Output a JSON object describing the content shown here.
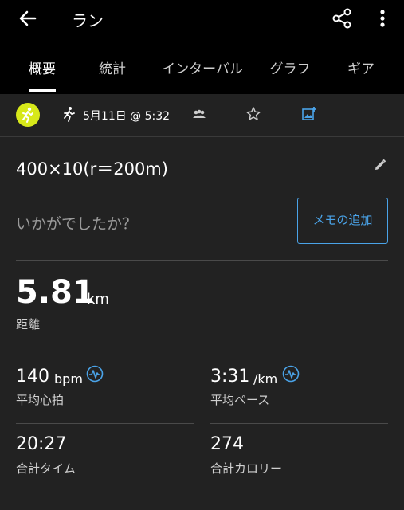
{
  "appbar": {
    "title": "ラン"
  },
  "tabs": [
    {
      "label": "概要"
    },
    {
      "label": "統計"
    },
    {
      "label": "インターバル"
    },
    {
      "label": "グラフ"
    },
    {
      "label": "ギア"
    }
  ],
  "activity": {
    "date": "5月11日 @ 5:32"
  },
  "workout": {
    "title": "400×10(r＝200m)"
  },
  "feedback": {
    "prompt": "いかがでしたか？",
    "memo_button": "メモの追加"
  },
  "distance": {
    "value": "5.81",
    "unit": "km",
    "label": "距離"
  },
  "stats": {
    "avg_hr": {
      "value": "140",
      "unit": "bpm",
      "label": "平均心拍"
    },
    "avg_pace": {
      "value": "3:31",
      "unit": "/km",
      "label": "平均ペース"
    },
    "total_time": {
      "value": "20:27",
      "label": "合計タイム"
    },
    "calories": {
      "value": "274",
      "label": "合計カロリー"
    }
  },
  "colors": {
    "accent": "#4aa3e8",
    "activity_icon": "#d7e81a",
    "background": "#222222",
    "header": "#000000"
  }
}
